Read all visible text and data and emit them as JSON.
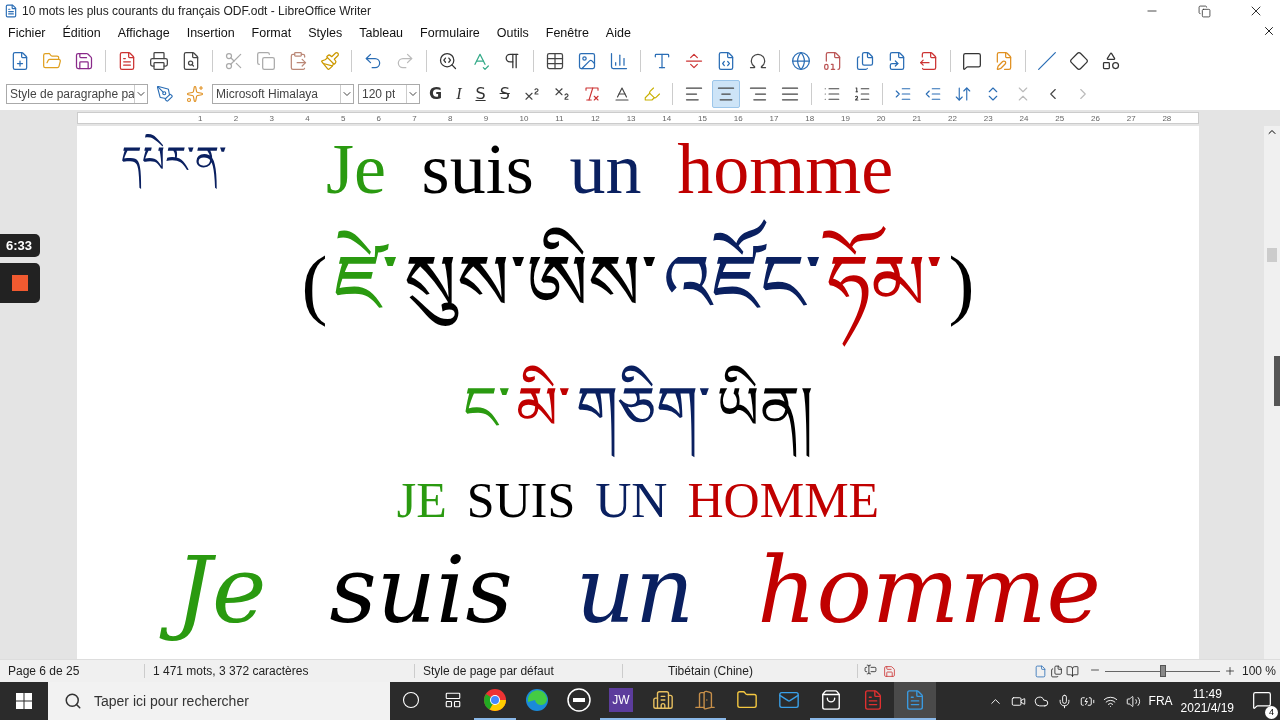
{
  "window": {
    "title": "10 mots les plus courants du français ODF.odt - LibreOffice Writer"
  },
  "menu": [
    "Fichier",
    "Édition",
    "Affichage",
    "Insertion",
    "Format",
    "Styles",
    "Tableau",
    "Formulaire",
    "Outils",
    "Fenêtre",
    "Aide"
  ],
  "format_bar": {
    "paragraph_style": "Style de paragraphe pa",
    "font": "Microsoft Himalaya",
    "size": "120 pt",
    "bold": "G",
    "italic": "I",
    "underline": "S",
    "strikethrough": "S",
    "alignments": [
      {
        "kind": "left",
        "selected": false
      },
      {
        "kind": "center",
        "selected": true
      },
      {
        "kind": "right",
        "selected": false
      },
      {
        "kind": "justify",
        "selected": false
      }
    ]
  },
  "ruler": [
    "1",
    "2",
    "3",
    "4",
    "5",
    "6",
    "7",
    "8",
    "9",
    "10",
    "11",
    "12",
    "13",
    "14",
    "15",
    "16",
    "17",
    "18",
    "19",
    "20",
    "21",
    "22",
    "23",
    "24",
    "25",
    "26",
    "27",
    "28"
  ],
  "recorder": {
    "time": "6:33"
  },
  "document": {
    "lines": [
      {
        "kind": "title",
        "label": "དཔེར་ན་",
        "segments": [
          {
            "text": "Je",
            "color": "#2a9a10"
          },
          {
            "text": "suis",
            "color": "#000000"
          },
          {
            "text": "un",
            "color": "#0a2060"
          },
          {
            "text": "homme",
            "color": "#c00000"
          }
        ]
      },
      {
        "kind": "tibetan_big",
        "segments": [
          {
            "text": "(",
            "color": "#000000"
          },
          {
            "text": "ཛེ་",
            "color": "#2a9a10"
          },
          {
            "text": "སུས་ཨིས་",
            "color": "#000000"
          },
          {
            "text": "འཛོང་",
            "color": "#0a2060"
          },
          {
            "text": "ཧོམ་",
            "color": "#c00000"
          },
          {
            "text": ")",
            "color": "#000000"
          }
        ]
      },
      {
        "kind": "tibetan",
        "segments": [
          {
            "text": "ང་",
            "color": "#2a9a10"
          },
          {
            "text": "མི་",
            "color": "#c00000"
          },
          {
            "text": "གཅིག་",
            "color": "#0a2060"
          },
          {
            "text": "ཡིན།",
            "color": "#000000"
          }
        ]
      },
      {
        "kind": "caps",
        "segments": [
          {
            "text": "JE",
            "color": "#2a9a10"
          },
          {
            "text": "SUIS",
            "color": "#000000"
          },
          {
            "text": "UN",
            "color": "#0a2060"
          },
          {
            "text": "HOMME",
            "color": "#c00000"
          }
        ]
      },
      {
        "kind": "cursive",
        "segments": [
          {
            "text": "Je",
            "color": "#2a9a10"
          },
          {
            "text": "suis",
            "color": "#000000"
          },
          {
            "text": "un",
            "color": "#0a2060"
          },
          {
            "text": "homme",
            "color": "#c00000"
          }
        ]
      }
    ]
  },
  "status_bar": {
    "page": "Page 6 de 25",
    "words": "1 471 mots, 3 372 caractères",
    "page_style": "Style de page par défaut",
    "language": "Tibétain (Chine)",
    "zoom": {
      "level": 0.5,
      "reading": "100 %"
    }
  },
  "taskbar": {
    "search": {
      "placeholder": "Taper ici pour rechercher"
    },
    "apps": [
      {
        "kind": "chrome",
        "running": true,
        "active": false
      },
      {
        "kind": "edge",
        "running": false,
        "active": false
      },
      {
        "kind": "dell",
        "running": false,
        "active": false
      },
      {
        "kind": "jw",
        "label": "JW",
        "running": true,
        "active": false
      },
      {
        "kind": "building",
        "running": true,
        "active": false
      },
      {
        "kind": "door",
        "running": true,
        "active": false
      },
      {
        "kind": "folder",
        "running": false,
        "active": false
      },
      {
        "kind": "mail",
        "running": false,
        "active": false
      },
      {
        "kind": "store",
        "running": true,
        "active": false
      },
      {
        "kind": "pdf",
        "running": true,
        "active": false
      },
      {
        "kind": "writer",
        "running": true,
        "active": true
      }
    ],
    "language": "FRA",
    "time": "11:49",
    "date": "2021/4/19",
    "notifications": "4"
  }
}
